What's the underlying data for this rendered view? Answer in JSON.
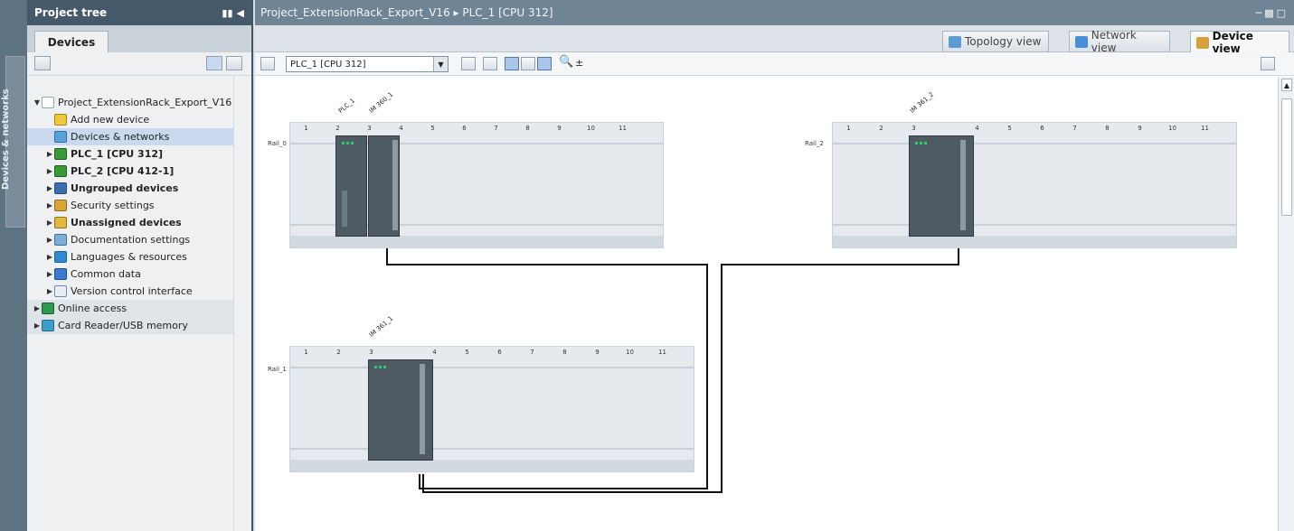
{
  "sidebar_strip": {
    "label": "Devices & networks"
  },
  "project_tree": {
    "header": "Project tree",
    "tab": "Devices",
    "items": [
      {
        "label": "Project_ExtensionRack_Export_V16",
        "icon": "project-icon"
      },
      {
        "label": "Add new device",
        "icon": "add-device-icon"
      },
      {
        "label": "Devices & networks",
        "icon": "network-icon"
      },
      {
        "label": "PLC_1 [CPU 312]",
        "icon": "plc-icon"
      },
      {
        "label": "PLC_2 [CPU 412-1]",
        "icon": "plc-icon"
      },
      {
        "label": "Ungrouped devices",
        "icon": "group-icon"
      },
      {
        "label": "Security settings",
        "icon": "security-icon"
      },
      {
        "label": "Unassigned devices",
        "icon": "unassigned-icon"
      },
      {
        "label": "Documentation settings",
        "icon": "documentation-icon"
      },
      {
        "label": "Languages & resources",
        "icon": "languages-icon"
      },
      {
        "label": "Common data",
        "icon": "common-data-icon"
      },
      {
        "label": "Version control interface",
        "icon": "version-control-icon"
      },
      {
        "label": "Online access",
        "icon": "online-access-icon"
      },
      {
        "label": "Card Reader/USB memory",
        "icon": "card-reader-icon"
      }
    ]
  },
  "main": {
    "breadcrumb": "Project_ExtensionRack_Export_V16  ▸  PLC_1 [CPU 312]",
    "view_tabs": {
      "topology": "Topology view",
      "network": "Network view",
      "device": "Device view"
    },
    "device_select": "PLC_1 [CPU 312]",
    "zoom_symbol": "±"
  },
  "racks": {
    "rail0": {
      "label": "Rail_0",
      "slots": [
        "1",
        "2",
        "3",
        "4",
        "5",
        "6",
        "7",
        "8",
        "9",
        "10",
        "11"
      ],
      "module_cpu": "PLC_1",
      "module_im": "IM 360_1"
    },
    "rail2": {
      "label": "Rail_2",
      "slots": [
        "1",
        "2",
        "3",
        "4",
        "5",
        "6",
        "7",
        "8",
        "9",
        "10",
        "11"
      ],
      "module_im": "IM 361_2"
    },
    "rail1": {
      "label": "Rail_1",
      "slots": [
        "1",
        "2",
        "3",
        "4",
        "5",
        "6",
        "7",
        "8",
        "9",
        "10",
        "11"
      ],
      "module_im": "IM 361_1"
    }
  }
}
